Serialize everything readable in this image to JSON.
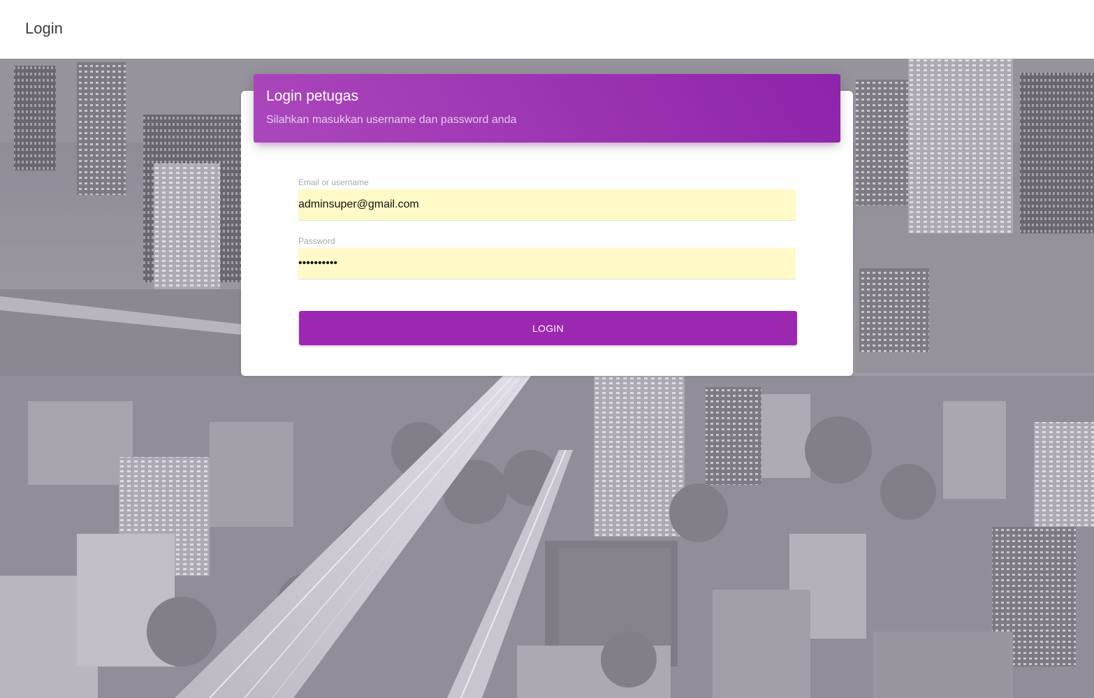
{
  "app": {
    "title": "Login"
  },
  "card": {
    "title": "Login petugas",
    "subtitle": "Silahkan masukkan username dan password anda"
  },
  "form": {
    "email": {
      "label": "Email or username",
      "value": "adminsuper@gmail.com"
    },
    "password": {
      "label": "Password",
      "value": "••••••••••"
    },
    "submit_label": "LOGIN"
  },
  "colors": {
    "accent": "#9c27b0",
    "header_gradient_start": "#ab47bc",
    "header_gradient_end": "#8e24aa",
    "autofill_background": "#fffac8"
  }
}
